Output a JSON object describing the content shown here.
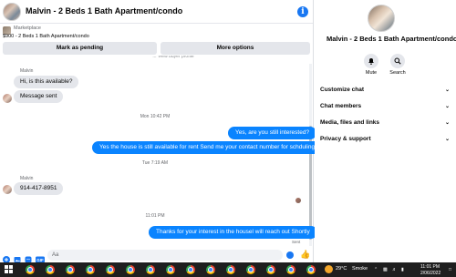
{
  "header": {
    "title": "Malvin - 2 Beds 1 Bath Apartment/condo",
    "info_icon": "info-icon"
  },
  "marketplace": {
    "label": "Marketplace",
    "listing": "$900 - 2 Beds 1 Bath Apartment/condo",
    "mark_pending_label": "Mark as pending",
    "more_options_label": "More options",
    "clipped_text": "... View buyer profile"
  },
  "messages": {
    "sender_name_1": "Malvin",
    "in_1": "Hi, is this available?",
    "in_2": "Message sent",
    "ts_1": "Mon 10:42 PM",
    "out_1": "Yes, are you still interested?",
    "out_2": "Yes the house is still available for rent Send me your contact number for schduling",
    "ts_2": "Tue 7:19 AM",
    "sender_name_2": "Malvin",
    "in_3": "914-417-8951",
    "ts_3": "11:01 PM",
    "out_3": "Thanks for your interest in the housel will reach out Shortly",
    "sent_status": "Sent"
  },
  "composer": {
    "placeholder": "Aa",
    "icons": [
      "plus-icon",
      "gallery-icon",
      "sticker-icon",
      "gif-icon",
      "emoji-icon",
      "like-icon"
    ]
  },
  "details": {
    "name": "Malvin - 2 Beds 1 Bath Apartment/condo",
    "mute_label": "Mute",
    "search_label": "Search",
    "sections": [
      {
        "label": "Customize chat"
      },
      {
        "label": "Chat members"
      },
      {
        "label": "Media, files and links"
      },
      {
        "label": "Privacy & support"
      }
    ]
  },
  "taskbar": {
    "weather": "29°C",
    "weather_desc": "Smoke",
    "time": "11:01 PM",
    "date": "2/06/2022"
  },
  "colors": {
    "accent": "#0a84ff",
    "bubble_in": "#e4e6eb",
    "taskbar": "#1f1f1f"
  }
}
